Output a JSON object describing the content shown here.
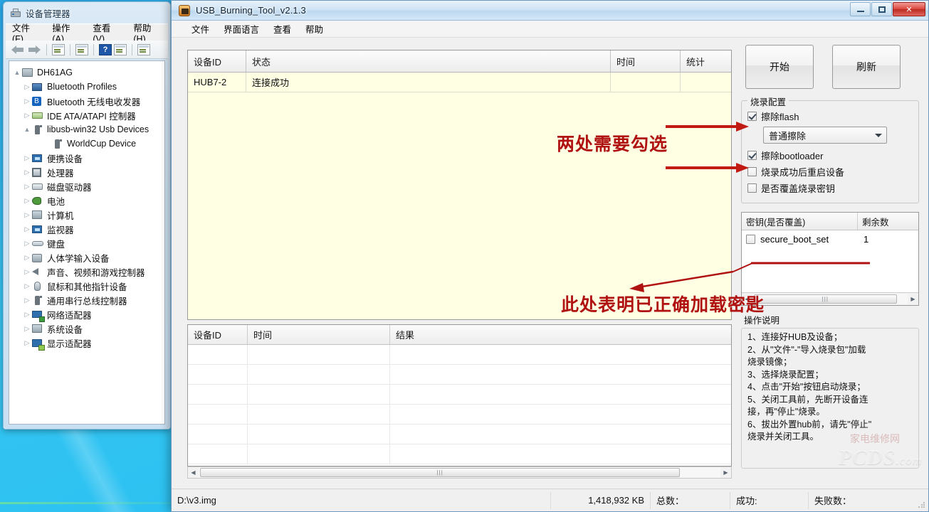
{
  "device_manager": {
    "title": "设备管理器",
    "menu": [
      "文件(F)",
      "操作(A)",
      "查看(V)",
      "帮助(H)"
    ],
    "toolbar_icons": [
      "back-arrow-icon",
      "forward-arrow-icon",
      "properties-icon",
      "update-driver-icon",
      "help-icon",
      "scan-icon",
      "search-icon"
    ],
    "tree": [
      {
        "label": "DH61AG",
        "level": 0,
        "twisty": "▲",
        "icon": "computer-icon"
      },
      {
        "label": "Bluetooth Profiles",
        "level": 1,
        "twisty": "▷",
        "icon": "bluetooth-profile-icon"
      },
      {
        "label": "Bluetooth 无线电收发器",
        "level": 1,
        "twisty": "▷",
        "icon": "bluetooth-icon"
      },
      {
        "label": "IDE ATA/ATAPI 控制器",
        "level": 1,
        "twisty": "▷",
        "icon": "ide-controller-icon"
      },
      {
        "label": "libusb-win32 Usb Devices",
        "level": 1,
        "twisty": "▲",
        "icon": "usb-icon"
      },
      {
        "label": "WorldCup Device",
        "level": 2,
        "twisty": "",
        "icon": "usb-device-icon"
      },
      {
        "label": "便携设备",
        "level": 1,
        "twisty": "▷",
        "icon": "portable-device-icon"
      },
      {
        "label": "处理器",
        "level": 1,
        "twisty": "▷",
        "icon": "cpu-icon"
      },
      {
        "label": "磁盘驱动器",
        "level": 1,
        "twisty": "▷",
        "icon": "disk-icon"
      },
      {
        "label": "电池",
        "level": 1,
        "twisty": "▷",
        "icon": "battery-icon"
      },
      {
        "label": "计算机",
        "level": 1,
        "twisty": "▷",
        "icon": "computer-node-icon"
      },
      {
        "label": "监视器",
        "level": 1,
        "twisty": "▷",
        "icon": "monitor-icon"
      },
      {
        "label": "键盘",
        "level": 1,
        "twisty": "▷",
        "icon": "keyboard-icon"
      },
      {
        "label": "人体学输入设备",
        "level": 1,
        "twisty": "▷",
        "icon": "hid-icon"
      },
      {
        "label": "声音、视频和游戏控制器",
        "level": 1,
        "twisty": "▷",
        "icon": "sound-icon"
      },
      {
        "label": "鼠标和其他指针设备",
        "level": 1,
        "twisty": "▷",
        "icon": "mouse-icon"
      },
      {
        "label": "通用串行总线控制器",
        "level": 1,
        "twisty": "▷",
        "icon": "usb-controller-icon"
      },
      {
        "label": "网络适配器",
        "level": 1,
        "twisty": "▷",
        "icon": "network-icon"
      },
      {
        "label": "系统设备",
        "level": 1,
        "twisty": "▷",
        "icon": "system-device-icon"
      },
      {
        "label": "显示适配器",
        "level": 1,
        "twisty": "▷",
        "icon": "display-adapter-icon"
      }
    ]
  },
  "usb_tool": {
    "title": "USB_Burning_Tool_v2.1.3",
    "window_buttons": {
      "minimize": "—",
      "maximize": "❐",
      "close": "✕"
    },
    "menu": [
      "文件",
      "界面语言",
      "查看",
      "帮助"
    ],
    "device_grid": {
      "columns": [
        "设备ID",
        "状态",
        "时间",
        "统计"
      ],
      "rows": [
        {
          "id": "HUB7-2",
          "status": "连接成功",
          "time": "",
          "stat": ""
        }
      ]
    },
    "result_grid": {
      "columns": [
        "设备ID",
        "时间",
        "结果"
      ],
      "rows": [
        {
          "id": "",
          "time": "",
          "result": ""
        },
        {
          "id": "",
          "time": "",
          "result": ""
        },
        {
          "id": "",
          "time": "",
          "result": ""
        },
        {
          "id": "",
          "time": "",
          "result": ""
        },
        {
          "id": "",
          "time": "",
          "result": ""
        },
        {
          "id": "",
          "time": "",
          "result": ""
        }
      ]
    },
    "buttons": {
      "start": "开始",
      "refresh": "刷新"
    },
    "burn_config": {
      "legend": "烧录配置",
      "erase_flash": {
        "label": "擦除flash",
        "checked": true
      },
      "erase_mode": {
        "value": "普通擦除"
      },
      "erase_bootloader": {
        "label": "擦除bootloader",
        "checked": true
      },
      "reboot_after": {
        "label": "烧录成功后重启设备",
        "checked": false
      },
      "overwrite_key": {
        "label": "是否覆盖烧录密钥",
        "checked": false
      }
    },
    "key_list": {
      "columns": [
        "密钥(是否覆盖)",
        "剩余数"
      ],
      "rows": [
        {
          "name": "secure_boot_set",
          "remaining": "1",
          "checked": false
        }
      ]
    },
    "instructions": {
      "legend": "操作说明",
      "lines": [
        "1、连接好HUB及设备；",
        "2、从\"文件\"-\"导入烧录包\"加载",
        "烧录镜像；",
        "3、选择烧录配置；",
        "4、点击\"开始\"按钮启动烧录；",
        "5、关闭工具前，先断开设备连",
        "接，再\"停止\"烧录。",
        "6、拔出外置hub前，请先\"停止\"",
        "烧录并关闭工具。"
      ]
    },
    "statusbar": {
      "path": "D:\\v3.img",
      "size": "1,418,932 KB",
      "total": "总数：",
      "success": "成功:",
      "fail": "失败数："
    }
  },
  "annotations": {
    "note_checkboxes": "两处需要勾选",
    "note_key_loaded": "此处表明已正确加载密匙",
    "color": "#B01212"
  },
  "watermark": {
    "main": "PCDS",
    "suffix": ".com",
    "secondary": "家电维修网"
  }
}
